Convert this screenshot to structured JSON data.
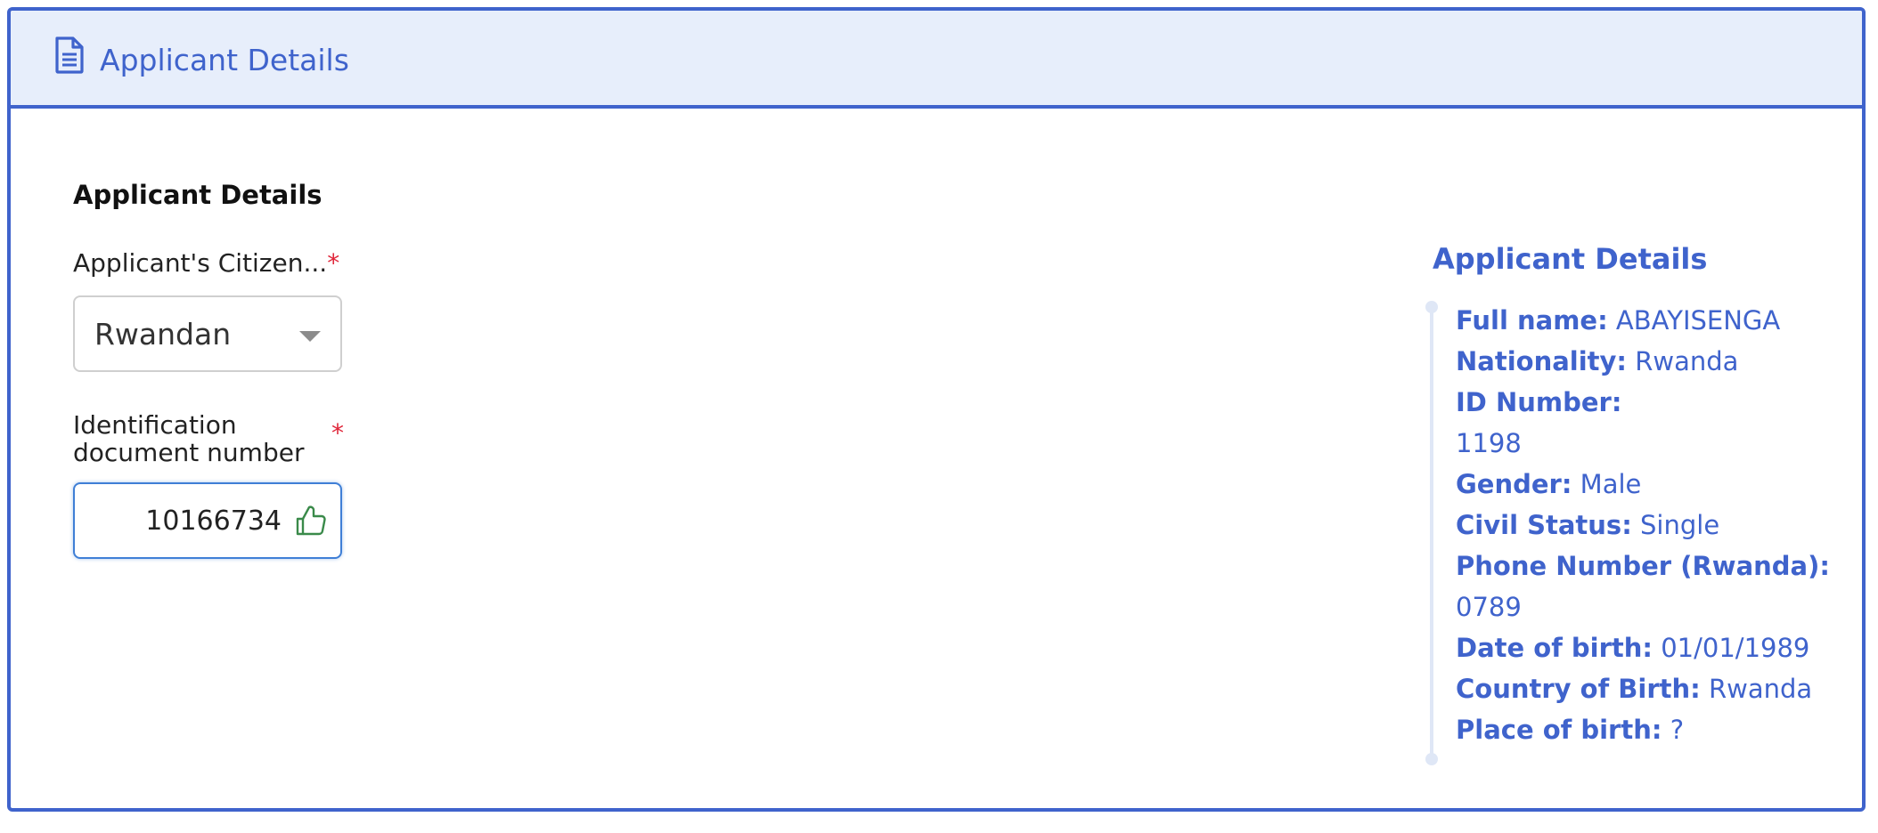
{
  "header": {
    "title": "Applicant Details"
  },
  "form": {
    "section_title": "Applicant Details",
    "citizenship_label": "Applicant's Citizen...",
    "citizenship_required": "*",
    "citizenship_value": "Rwandan",
    "id_label_line1": "Identification",
    "id_label_line2": "document number",
    "id_required": "*",
    "id_value": "10166734"
  },
  "details": {
    "title": "Applicant Details",
    "full_name_label": "Full name:",
    "full_name_value": "ABAYISENGA",
    "nationality_label": "Nationality:",
    "nationality_value": "Rwanda",
    "id_number_label": "ID Number:",
    "id_number_value": "1198",
    "gender_label": "Gender:",
    "gender_value": "Male",
    "civil_status_label": "Civil Status:",
    "civil_status_value": "Single",
    "phone_label": "Phone Number (Rwanda):",
    "phone_value": "0789",
    "dob_label": "Date of birth:",
    "dob_value": "01/01/1989",
    "country_birth_label": "Country of Birth:",
    "country_birth_value": "Rwanda",
    "place_birth_label": "Place of birth:",
    "place_birth_value": "?"
  },
  "colors": {
    "accent": "#3f63cc",
    "header_bg": "#e7eefb",
    "required": "#e0263a",
    "success_icon": "#3a8a4a"
  },
  "icons": {
    "header": "document-icon",
    "select": "caret-down-icon",
    "input_status": "thumbs-up-icon"
  }
}
